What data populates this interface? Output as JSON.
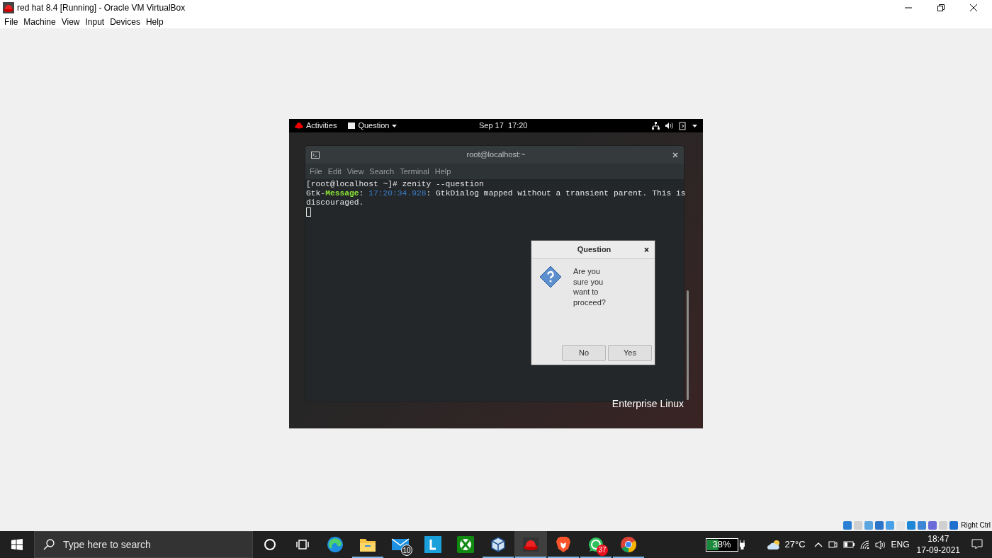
{
  "window": {
    "title": "red hat 8.4 [Running] - Oracle VM VirtualBox",
    "menu": [
      "File",
      "Machine",
      "View",
      "Input",
      "Devices",
      "Help"
    ]
  },
  "vm": {
    "topbar": {
      "activities": "Activities",
      "app_menu": "Question",
      "clock": "Sep 17  17:20"
    },
    "terminal": {
      "title": "root@localhost:~",
      "menu": [
        "File",
        "Edit",
        "View",
        "Search",
        "Terminal",
        "Help"
      ],
      "lines": [
        [
          {
            "kind": "plain",
            "text": "[root@localhost ~]# zenity --question"
          }
        ],
        [
          {
            "kind": "plain",
            "text": "Gtk-"
          },
          {
            "kind": "keyword",
            "text": "Message"
          },
          {
            "kind": "plain",
            "text": ": "
          },
          {
            "kind": "timestamp",
            "text": "17:20:34.928"
          },
          {
            "kind": "plain",
            "text": ": GtkDialog mapped without a transient parent. This is"
          }
        ],
        [
          {
            "kind": "plain",
            "text": "discouraged."
          }
        ]
      ]
    },
    "brand": "Enterprise Linux",
    "dialog": {
      "title": "Question",
      "close": "×",
      "message": "Are you sure you want to proceed?",
      "buttons": [
        "No",
        "Yes"
      ]
    }
  },
  "vbox_status": {
    "hotkey": "Right Ctrl"
  },
  "taskbar": {
    "search_placeholder": "Type here to search",
    "apps": [
      {
        "kind": "cortana",
        "running": false,
        "active": false
      },
      {
        "kind": "taskview",
        "running": false,
        "active": false
      },
      {
        "kind": "edge",
        "running": false,
        "active": false
      },
      {
        "kind": "explorer",
        "running": true,
        "active": false
      },
      {
        "kind": "mail",
        "running": false,
        "active": false,
        "badge": "10"
      },
      {
        "kind": "launcher",
        "running": false,
        "active": false
      },
      {
        "kind": "xbox",
        "running": false,
        "active": false
      },
      {
        "kind": "virtualbox",
        "running": true,
        "active": false
      },
      {
        "kind": "redhat",
        "running": true,
        "active": true
      },
      {
        "kind": "brave",
        "running": true,
        "active": false
      },
      {
        "kind": "whatsapp",
        "running": true,
        "active": false,
        "badge": "37"
      },
      {
        "kind": "chrome",
        "running": true,
        "active": false
      }
    ],
    "battery": {
      "level": 0.38,
      "text": "38%"
    },
    "weather": "27°C",
    "language": "ENG",
    "time": "18:47",
    "date": "17-09-2021"
  }
}
